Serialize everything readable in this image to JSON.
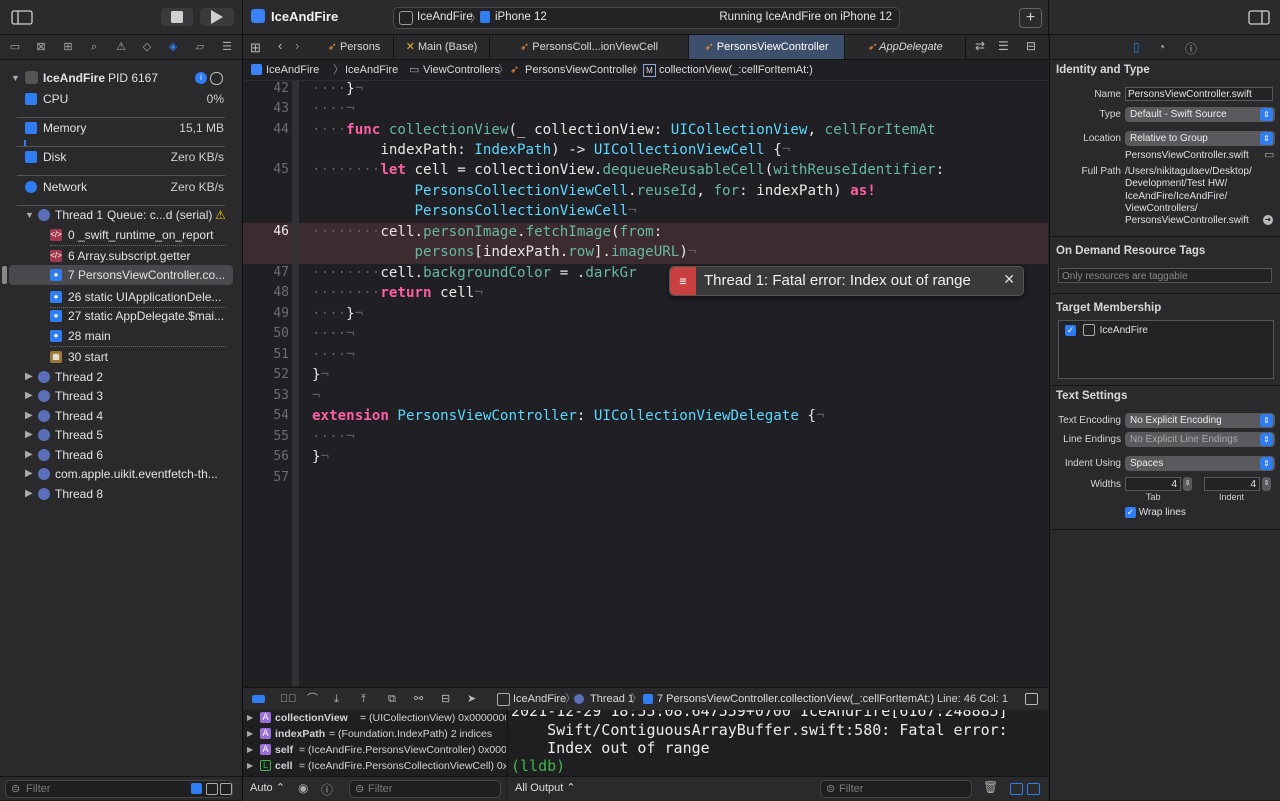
{
  "toolbar": {
    "project_title": "IceAndFire",
    "scheme": "IceAndFire",
    "device": "iPhone 12",
    "status": "Running IceAndFire on iPhone 12"
  },
  "navigator": {
    "process": {
      "name": "IceAndFire",
      "pid": "PID 6167"
    },
    "gauges": [
      {
        "name": "CPU",
        "value": "0%"
      },
      {
        "name": "Memory",
        "value": "15,1 MB"
      },
      {
        "name": "Disk",
        "value": "Zero KB/s"
      },
      {
        "name": "Network",
        "value": "Zero KB/s"
      }
    ],
    "thread1": {
      "label": "Thread 1",
      "queue": "Queue: c...d (serial)"
    },
    "frames": [
      "0 _swift_runtime_on_report",
      "6 Array.subscript.getter",
      "7 PersonsViewController.co...",
      "26 static UIApplicationDele...",
      "27 static AppDelegate.$mai...",
      "28 main",
      "30 start"
    ],
    "threads": [
      "Thread 2",
      "Thread 3",
      "Thread 4",
      "Thread 5",
      "Thread 6",
      "com.apple.uikit.eventfetch-th...",
      "Thread 8"
    ],
    "filter_placeholder": "Filter"
  },
  "editor": {
    "tabs": [
      "Persons",
      "Main (Base)",
      "PersonsColl...ionViewCell",
      "PersonsViewController",
      "AppDelegate"
    ],
    "jumpbar": [
      "IceAndFire",
      "IceAndFire",
      "ViewControllers",
      "PersonsViewController",
      "collectionView(_:cellForItemAt:)"
    ],
    "line_numbers": [
      "42",
      "43",
      "44",
      "45",
      "46",
      "47",
      "48",
      "49",
      "50",
      "51",
      "52",
      "53",
      "54",
      "55",
      "56",
      "57"
    ],
    "error_banner": "Thread 1: Fatal error: Index out of range"
  },
  "debugbar": {
    "crumbs": [
      "IceAndFire",
      "Thread 1",
      "7 PersonsViewController.collectionView(_:cellForItemAt:)"
    ],
    "position": "Line: 46  Col: 1"
  },
  "variables": [
    {
      "kind": "A",
      "name": "collectionView",
      "value": "= (UICollectionView) 0x0000000..."
    },
    {
      "kind": "A",
      "name": "indexPath",
      "value": "= (Foundation.IndexPath) 2 indices"
    },
    {
      "kind": "A",
      "name": "self",
      "value": "= (IceAndFire.PersonsViewController) 0x0000..."
    },
    {
      "kind": "L",
      "name": "cell",
      "value": "= (IceAndFire.PersonsCollectionViewCell) 0x0..."
    }
  ],
  "console": {
    "lines": [
      "2021-12-29 18:55:08.647559+0700 IceAndFire[6167:248885]",
      "    Swift/ContiguousArrayBuffer.swift:580: Fatal error:",
      "    Index out of range"
    ],
    "prompt": "(lldb)"
  },
  "bottom": {
    "auto": "Auto",
    "filter_placeholder": "Filter",
    "output": "All Output",
    "console_filter_placeholder": "Filter"
  },
  "inspector": {
    "identity_title": "Identity and Type",
    "name_label": "Name",
    "name_value": "PersonsViewController.swift",
    "type_label": "Type",
    "type_value": "Default - Swift Source",
    "location_label": "Location",
    "location_value": "Relative to Group",
    "location_file": "PersonsViewController.swift",
    "fullpath_label": "Full Path",
    "fullpath_lines": [
      "/Users/nikitagulaev/Desktop/",
      "Development/Test HW/",
      "IceAndFire/IceAndFire/",
      "ViewControllers/",
      "PersonsViewController.swift"
    ],
    "odr_title": "On Demand Resource Tags",
    "odr_placeholder": "Only resources are taggable",
    "target_title": "Target Membership",
    "target_name": "IceAndFire",
    "text_title": "Text Settings",
    "encoding_label": "Text Encoding",
    "encoding_value": "No Explicit Encoding",
    "endings_label": "Line Endings",
    "endings_value": "No Explicit Line Endings",
    "indent_label": "Indent Using",
    "indent_value": "Spaces",
    "widths_label": "Widths",
    "tab_value": "4",
    "indent_value_num": "4",
    "tab_caption": "Tab",
    "indent_caption": "Indent",
    "wrap_label": "Wrap lines"
  },
  "colors": {
    "accent": "#2f7df0",
    "keyword": "#fc5fa3",
    "type": "#5dd8ff",
    "method": "#67b7a4",
    "error": "#c94040"
  }
}
